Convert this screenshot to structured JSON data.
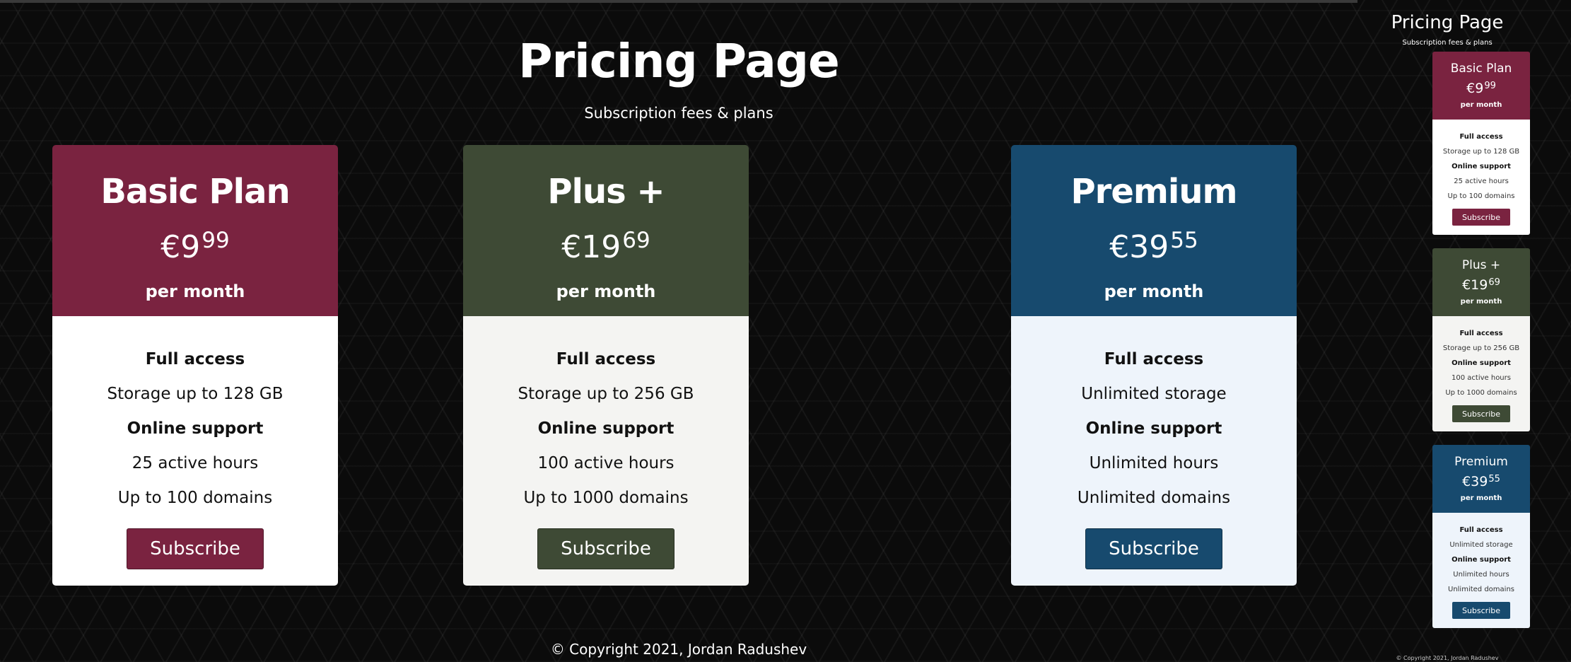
{
  "page": {
    "title": "Pricing Page",
    "subtitle": "Subscription fees & plans",
    "footer": "© Copyright 2021, Jordan Radushev"
  },
  "plans": [
    {
      "name": "Basic Plan",
      "currency": "€",
      "price_whole": "9",
      "price_cents": "99",
      "period": "per month",
      "features": [
        "Full access",
        "Storage up to 128 GB",
        "Online support",
        "25 active hours",
        "Up to 100 domains"
      ],
      "button": "Subscribe",
      "color": "#7a2340",
      "body_bg": "#ffffff"
    },
    {
      "name": "Plus +",
      "currency": "€",
      "price_whole": "19",
      "price_cents": "69",
      "period": "per month",
      "features": [
        "Full access",
        "Storage up to 256 GB",
        "Online support",
        "100 active hours",
        "Up to 1000 domains"
      ],
      "button": "Subscribe",
      "color": "#3e4a35",
      "body_bg": "#f4f4f2"
    },
    {
      "name": "Premium",
      "currency": "€",
      "price_whole": "39",
      "price_cents": "55",
      "period": "per month",
      "features": [
        "Full access",
        "Unlimited storage",
        "Online support",
        "Unlimited hours",
        "Unlimited domains"
      ],
      "button": "Subscribe",
      "color": "#174a6e",
      "body_bg": "#eef4fb"
    }
  ]
}
